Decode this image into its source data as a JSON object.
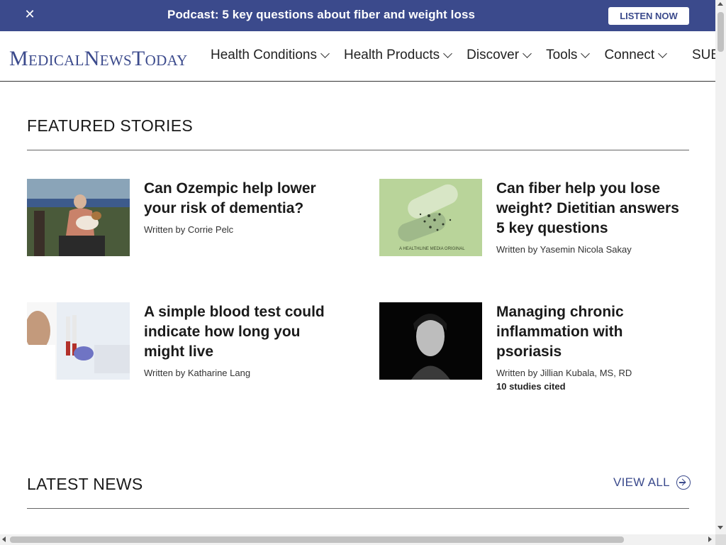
{
  "banner": {
    "close_label": "✕",
    "title": "Podcast: 5 key questions about fiber and weight loss",
    "cta": "LISTEN NOW"
  },
  "header": {
    "logo": {
      "m": "M",
      "edical": "EDICAL",
      "n": "N",
      "ews": "EWS",
      "t": "T",
      "oday": "ODAY"
    },
    "nav": [
      "Health Conditions",
      "Health Products",
      "Discover",
      "Tools",
      "Connect"
    ],
    "sub_label": "SUB"
  },
  "featured": {
    "heading": "FEATURED STORIES",
    "stories": [
      {
        "title": "Can Ozempic help lower your risk of dementia?",
        "byline": "Written by Corrie Pelc",
        "cited": ""
      },
      {
        "title": "Can fiber help you lose weight? Dietitian answers 5 key questions",
        "byline": "Written by Yasemin Nicola Sakay",
        "cited": "",
        "image_caption": "A HEALTHLINE MEDIA ORIGINAL"
      },
      {
        "title": "A simple blood test could indicate how long you might live",
        "byline": "Written by Katharine Lang",
        "cited": ""
      },
      {
        "title": "Managing chronic inflammation with psoriasis",
        "byline": "Written by Jillian Kubala, MS, RD",
        "cited": "10 studies cited"
      }
    ]
  },
  "latest": {
    "heading": "LATEST NEWS",
    "view_all": "VIEW ALL"
  },
  "colors": {
    "brand": "#3b4a8c",
    "text": "#1a1a1a"
  }
}
